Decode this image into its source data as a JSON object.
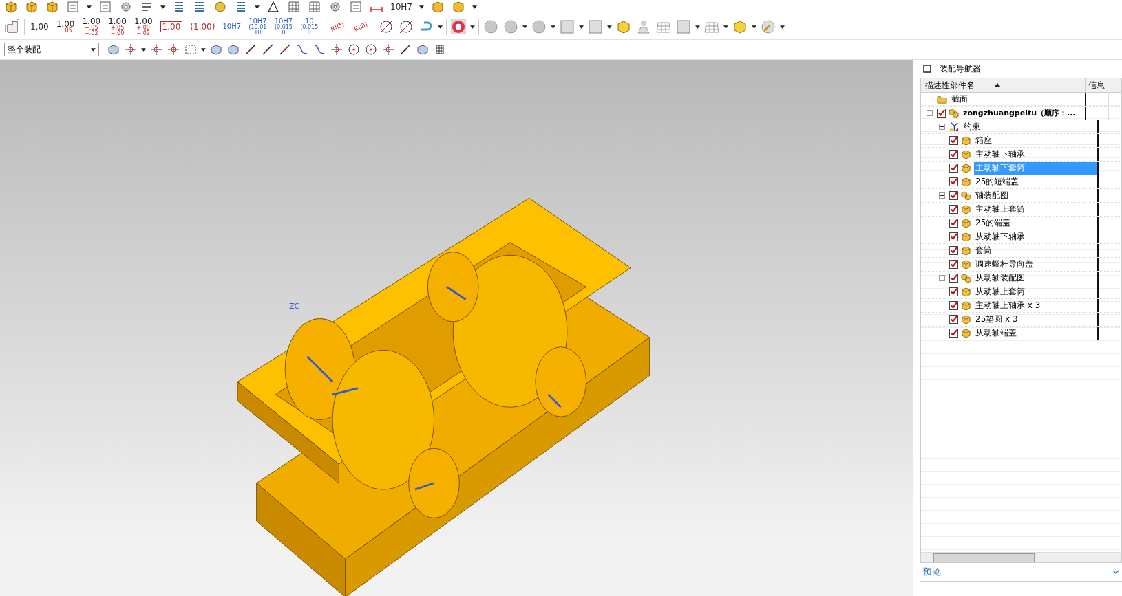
{
  "toolbar_top": {
    "dim_style": "10H7"
  },
  "toolbar_dims": [
    {
      "kind": "plain",
      "lines": [
        "1.00"
      ]
    },
    {
      "kind": "tol",
      "lines": [
        "1.00",
        "±.05"
      ]
    },
    {
      "kind": "tol",
      "lines": [
        "1.00",
        "+.05",
        "−.02"
      ]
    },
    {
      "kind": "tol",
      "lines": [
        "1.00",
        "+.05",
        "−.00"
      ]
    },
    {
      "kind": "tol",
      "lines": [
        "1.00",
        "+.00",
        "−.02"
      ]
    },
    {
      "kind": "boxed",
      "lines": [
        "1.00"
      ]
    },
    {
      "kind": "ref",
      "lines": [
        "(1.00)"
      ]
    },
    {
      "kind": "fit",
      "lines": [
        "10H7"
      ]
    },
    {
      "kind": "fit",
      "lines": [
        "10H7",
        "(10.01",
        "10"
      ]
    },
    {
      "kind": "fit",
      "lines": [
        "10H7",
        "(0.015",
        "0"
      ]
    },
    {
      "kind": "fit",
      "lines": [
        "10",
        "(0.015",
        "0"
      ]
    }
  ],
  "radius_tools": [
    "R(Ø)",
    "R(Ø)"
  ],
  "assembly_filter": "整个装配",
  "viewport": {
    "axis_label": "ZC"
  },
  "navigator": {
    "title": "装配导航器",
    "columns": [
      "描述性部件名",
      "信息"
    ],
    "tree": [
      {
        "kind": "folder",
        "label": "截面"
      },
      {
        "kind": "assembly",
        "label": "zongzhuangpeitu（顺序：...",
        "checked": true,
        "selected": false,
        "expanded": true,
        "children": [
          {
            "kind": "constraint",
            "label": "约束",
            "expanded": false
          },
          {
            "kind": "part",
            "label": "箱座",
            "checked": true,
            "selected": false
          },
          {
            "kind": "part",
            "label": "主动轴下轴承",
            "checked": true,
            "selected": false
          },
          {
            "kind": "part",
            "label": "主动轴下套筒",
            "checked": true,
            "selected": true
          },
          {
            "kind": "part",
            "label": "25的短端盖",
            "checked": true,
            "selected": false
          },
          {
            "kind": "assembly",
            "label": "轴装配图",
            "checked": true,
            "selected": false,
            "expanded": false
          },
          {
            "kind": "part",
            "label": "主动轴上套筒",
            "checked": true,
            "selected": false
          },
          {
            "kind": "part",
            "label": "25的端盖",
            "checked": true,
            "selected": false
          },
          {
            "kind": "part",
            "label": "从动轴下轴承",
            "checked": true,
            "selected": false
          },
          {
            "kind": "part",
            "label": "套筒",
            "checked": true,
            "selected": false
          },
          {
            "kind": "part",
            "label": "调速螺杆导向盖",
            "checked": true,
            "selected": false
          },
          {
            "kind": "assembly",
            "label": "从动轴装配图",
            "checked": true,
            "selected": false,
            "expanded": false
          },
          {
            "kind": "part",
            "label": "从动轴上套筒",
            "checked": true,
            "selected": false
          },
          {
            "kind": "part",
            "label": "主动轴上轴承 x 3",
            "checked": true,
            "selected": false
          },
          {
            "kind": "part",
            "label": "25垫圆 x 3",
            "checked": true,
            "selected": false
          },
          {
            "kind": "part",
            "label": "从动轴端盖",
            "checked": true,
            "selected": false
          }
        ]
      }
    ],
    "preview_label": "预览"
  }
}
